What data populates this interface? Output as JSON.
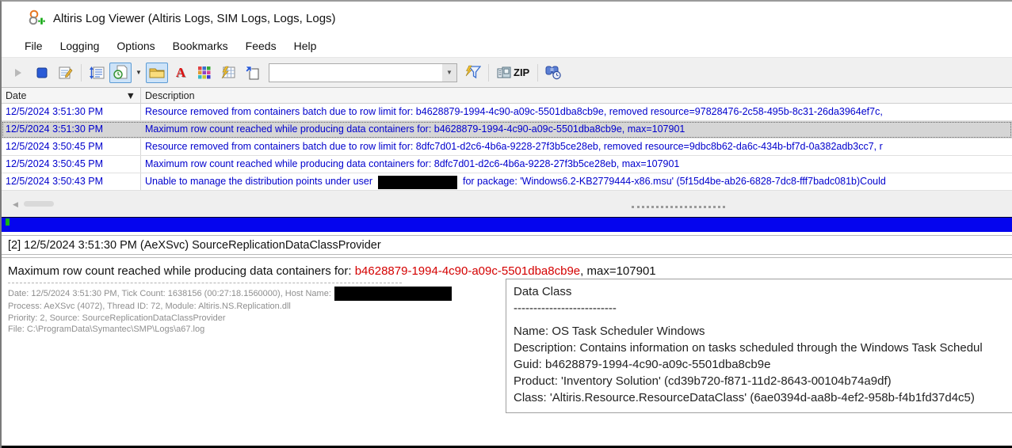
{
  "window": {
    "title": "Altiris Log Viewer (Altiris Logs, SIM Logs, Logs, Logs)"
  },
  "menu": {
    "items": [
      "File",
      "Logging",
      "Options",
      "Bookmarks",
      "Feeds",
      "Help"
    ]
  },
  "toolbar": {
    "search_value": "",
    "search_placeholder": "",
    "zip_label": "ZIP"
  },
  "table": {
    "columns": [
      "Date",
      "Description"
    ],
    "rows": [
      {
        "date": "12/5/2024 3:51:30 PM",
        "description": "Resource removed from containers batch due to row limit for: b4628879-1994-4c90-a09c-5501dba8cb9e, removed resource=97828476-2c58-495b-8c31-26da3964ef7c,"
      },
      {
        "date": "12/5/2024 3:51:30 PM",
        "description": "Maximum row count reached while producing data containers for: b4628879-1994-4c90-a09c-5501dba8cb9e, max=107901"
      },
      {
        "date": "12/5/2024 3:50:45 PM",
        "description": "Resource removed from containers batch due to row limit for: 8dfc7d01-d2c6-4b6a-9228-27f3b5ce28eb, removed resource=9dbc8b62-da6c-434b-bf7d-0a382adb3cc7, r"
      },
      {
        "date": "12/5/2024 3:50:45 PM",
        "description": "Maximum row count reached while producing data containers for: 8dfc7d01-d2c6-4b6a-9228-27f3b5ce28eb, max=107901"
      },
      {
        "date": "12/5/2024 3:50:43 PM",
        "description_prefix": "Unable to manage the distribution points under user",
        "description_suffix": "for package: 'Windows6.2-KB2779444-x86.msu' (5f15d4be-ab26-6828-7dc8-fff7badc081b)Could"
      }
    ]
  },
  "detail": {
    "header": "[2] 12/5/2024 3:51:30 PM (AeXSvc) SourceReplicationDataClassProvider",
    "message_prefix": "Maximum row count reached while producing data containers for: ",
    "message_guid": "b4628879-1994-4c90-a09c-5501dba8cb9e",
    "message_suffix": ", max=107901",
    "meta_line1_prefix": "Date: 12/5/2024 3:51:30 PM, Tick Count: 1638156 (00:27:18.1560000), Host Name:",
    "meta_line2": "Process: AeXSvc (4072), Thread ID: 72, Module: Altiris.NS.Replication.dll",
    "meta_line3": "Priority: 2, Source: SourceReplicationDataClassProvider",
    "meta_line4": "File: C:\\ProgramData\\Symantec\\SMP\\Logs\\a67.log"
  },
  "tooltip": {
    "title": "Data Class",
    "divider": "--------------------------",
    "name": "Name: OS Task Scheduler Windows",
    "description": "Description: Contains information on tasks scheduled through the Windows Task Schedul",
    "guid": "Guid: b4628879-1994-4c90-a09c-5501dba8cb9e",
    "product": "Product: 'Inventory Solution' (cd39b720-f871-11d2-8643-00104b74a9df)",
    "class": "Class: 'Altiris.Resource.ResourceDataClass' (6ae0394d-aa8b-4ef2-958b-f4b1fd37d4c5)"
  },
  "colors": {
    "row_text": "#0000cd",
    "selected_row_bg": "#d5d5d5",
    "guid_red": "#d40000",
    "progress_blue": "#0505ee",
    "toolbar_bg": "#f0f0f0",
    "toggle_highlight": "#cde3f8"
  }
}
